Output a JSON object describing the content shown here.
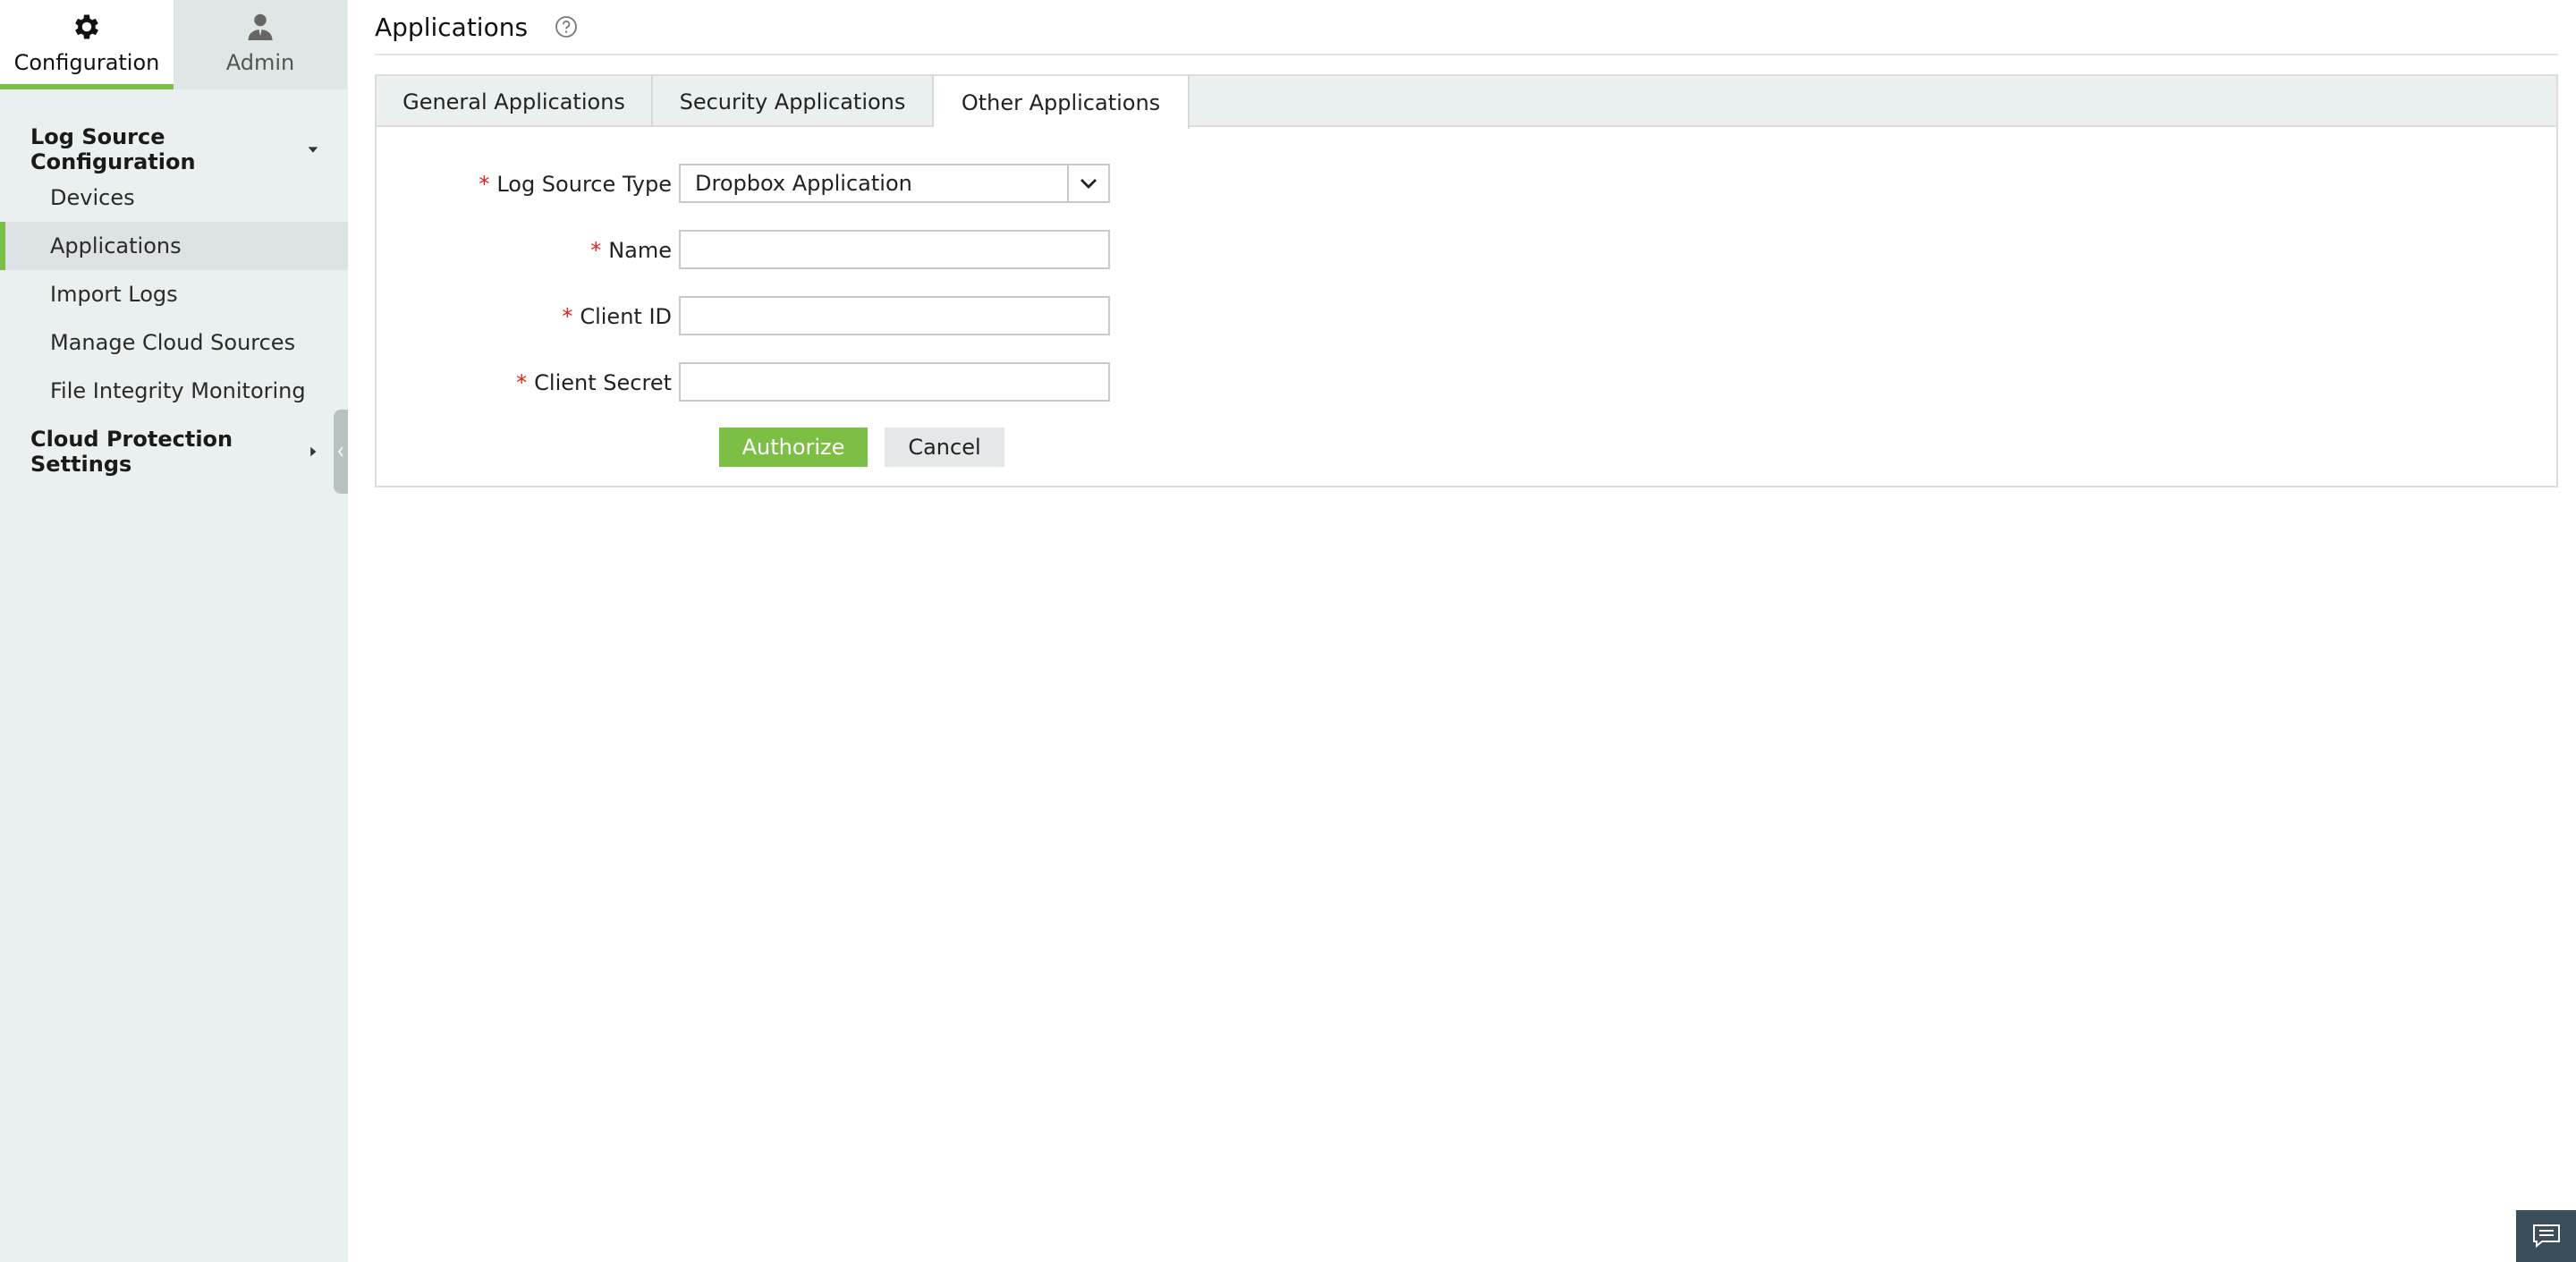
{
  "top_tabs": {
    "configuration": "Configuration",
    "admin": "Admin"
  },
  "sidebar": {
    "groups": [
      {
        "label": "Log Source Configuration",
        "items": [
          {
            "label": "Devices"
          },
          {
            "label": "Applications"
          },
          {
            "label": "Import Logs"
          },
          {
            "label": "Manage Cloud Sources"
          },
          {
            "label": "File Integrity Monitoring"
          }
        ]
      },
      {
        "label": "Cloud Protection Settings"
      }
    ],
    "active_item": "Applications"
  },
  "page": {
    "title": "Applications"
  },
  "tabs": [
    {
      "label": "General Applications"
    },
    {
      "label": "Security Applications"
    },
    {
      "label": "Other Applications"
    }
  ],
  "active_tab": "Other Applications",
  "form": {
    "required_mark": "*",
    "log_source_type": {
      "label": "Log Source Type",
      "value": "Dropbox Application"
    },
    "name": {
      "label": "Name",
      "value": ""
    },
    "client_id": {
      "label": "Client ID",
      "value": ""
    },
    "client_secret": {
      "label": "Client Secret",
      "value": ""
    },
    "authorize_label": "Authorize",
    "cancel_label": "Cancel"
  },
  "colors": {
    "accent": "#7cbf45",
    "sidebar_bg": "#eaf0f0",
    "required": "#e02020",
    "chat_bg": "#3a4f5b"
  }
}
